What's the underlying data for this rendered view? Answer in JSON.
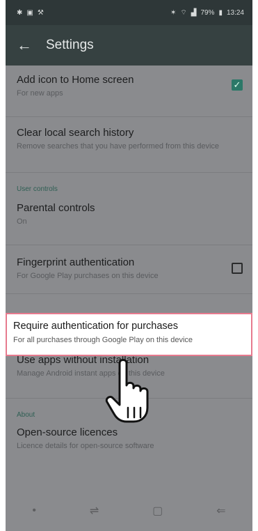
{
  "status_bar": {
    "left_icons": [
      "notification-icon",
      "image-icon",
      "tools-icon"
    ],
    "battery": "79%",
    "time": "13:24"
  },
  "app_bar": {
    "title": "Settings"
  },
  "rows": [
    {
      "title": "Add icon to Home screen",
      "subtitle": "For new apps",
      "checkbox": true
    },
    {
      "title": "Clear local search history",
      "subtitle": "Remove searches that you have performed from this device"
    }
  ],
  "user_controls_header": "User controls",
  "user_rows": [
    {
      "title": "Parental controls",
      "subtitle": "On"
    },
    {
      "title": "Fingerprint authentication",
      "subtitle": "For Google Play purchases on this device",
      "checkbox": false
    }
  ],
  "highlighted": {
    "title": "Require authentication for purchases",
    "subtitle": "For all purchases through Google Play on this device"
  },
  "instant": {
    "title": "Use apps without installation",
    "subtitle": "Manage Android instant apps on this device"
  },
  "about_header": "About",
  "about_rows": [
    {
      "title": "Open-source licences",
      "subtitle": "Licence details for open-source software"
    }
  ],
  "nav_icons": [
    "dot-icon",
    "recent-apps-icon",
    "home-icon",
    "back-icon"
  ]
}
